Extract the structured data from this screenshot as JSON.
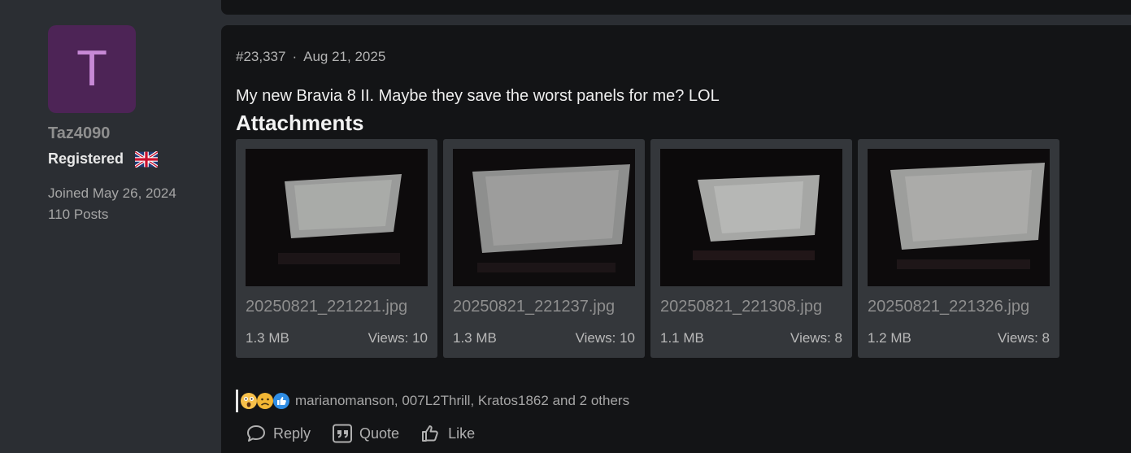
{
  "user": {
    "avatar_letter": "T",
    "username": "Taz4090",
    "role": "Registered",
    "flag_icon": "uk-flag-icon",
    "joined": "Joined May 26, 2024",
    "posts": "110 Posts"
  },
  "post": {
    "number": "#23,337",
    "separator": "·",
    "date": "Aug 21, 2025",
    "text": "My new Bravia 8 II. Maybe they save the worst panels for me? LOL",
    "attachments_title": "Attachments",
    "attachments": [
      {
        "name": "20250821_221221.jpg",
        "size": "1.3 MB",
        "views": "Views: 10"
      },
      {
        "name": "20250821_221237.jpg",
        "size": "1.3 MB",
        "views": "Views: 10"
      },
      {
        "name": "20250821_221308.jpg",
        "size": "1.1 MB",
        "views": "Views: 8"
      },
      {
        "name": "20250821_221326.jpg",
        "size": "1.2 MB",
        "views": "Views: 8"
      }
    ],
    "reactions": {
      "icons": [
        "wow-emoji-icon",
        "confused-emoji-icon",
        "like-reaction-icon"
      ],
      "text": "marianomanson, 007L2Thrill, Kratos1862 and 2 others"
    },
    "actions": [
      {
        "label": "Reply",
        "icon": "reply-icon"
      },
      {
        "label": "Quote",
        "icon": "quote-icon"
      },
      {
        "label": "Like",
        "icon": "like-icon"
      }
    ]
  },
  "colors": {
    "background": "#2b2e33",
    "post_bg": "#131416",
    "avatar_bg": "#4d2456",
    "avatar_letter": "#c789d6",
    "attachment_card": "#34373b"
  }
}
